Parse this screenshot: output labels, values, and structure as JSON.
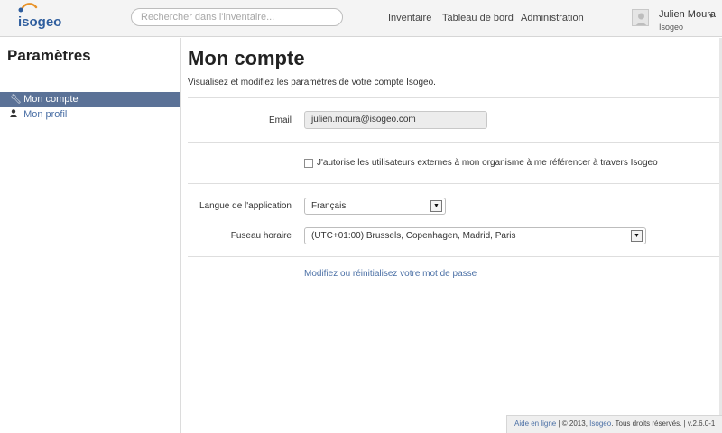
{
  "brand": {
    "logo_text": "isogeo"
  },
  "search": {
    "placeholder": "Rechercher dans l'inventaire..."
  },
  "nav": {
    "items": [
      {
        "label": "Inventaire"
      },
      {
        "label": "Tableau de bord"
      },
      {
        "label": "Administration"
      }
    ]
  },
  "user": {
    "name": "Julien Moura",
    "org": "Isogeo"
  },
  "sidebar": {
    "title": "Paramètres",
    "items": [
      {
        "label": "Mon compte",
        "icon": "wrench-icon",
        "active": true
      },
      {
        "label": "Mon profil",
        "icon": "user-icon",
        "active": false
      }
    ]
  },
  "main": {
    "title": "Mon compte",
    "subtitle": "Visualisez et modifiez les paramètres de votre compte Isogeo.",
    "email": {
      "label": "Email",
      "value": "julien.moura@isogeo.com"
    },
    "consent": {
      "label": "J'autorise les utilisateurs externes à mon organisme à me référencer à travers Isogeo",
      "checked": false
    },
    "language": {
      "label": "Langue de l'application",
      "value": "Français"
    },
    "timezone": {
      "label": "Fuseau horaire",
      "value": "(UTC+01:00) Brussels, Copenhagen, Madrid, Paris"
    },
    "password_link": "Modifiez ou réinitialisez votre mot de passe"
  },
  "footer": {
    "help": "Aide en ligne",
    "sep1": " | © 2013, ",
    "company": "Isogeo",
    "rights": ". Tous droits réservés. | v.2.6.0-1"
  },
  "colors": {
    "accent": "#5b7297",
    "link": "#4a6fa5",
    "logo_blue": "#2f5e9e",
    "logo_orange": "#e8932a"
  }
}
